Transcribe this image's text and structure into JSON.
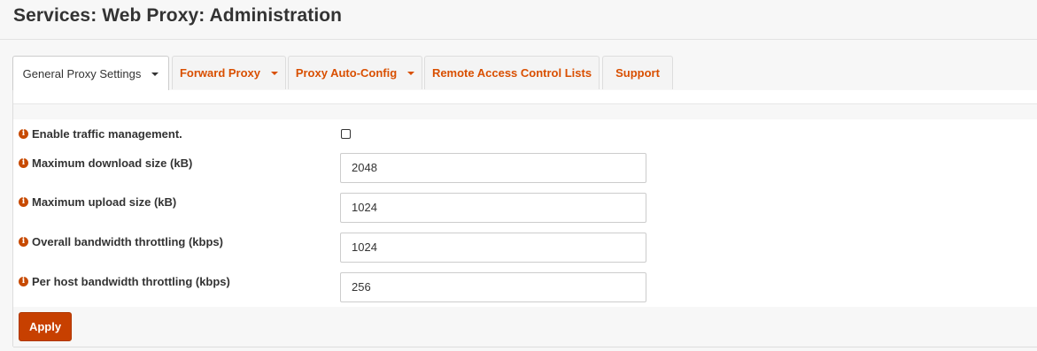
{
  "header": {
    "title": "Services: Web Proxy: Administration"
  },
  "tabs": [
    {
      "label": "General Proxy Settings",
      "active": true,
      "has_dropdown": true
    },
    {
      "label": "Forward Proxy",
      "active": false,
      "has_dropdown": true
    },
    {
      "label": "Proxy Auto-Config",
      "active": false,
      "has_dropdown": true
    },
    {
      "label": "Remote Access Control Lists",
      "active": false,
      "has_dropdown": false
    },
    {
      "label": "Support",
      "active": false,
      "has_dropdown": false
    }
  ],
  "form": {
    "enable_traffic": {
      "label": "Enable traffic management.",
      "checked": false,
      "icon": "info-icon"
    },
    "max_download": {
      "label": "Maximum download size (kB)",
      "value": "2048",
      "icon": "info-icon"
    },
    "max_upload": {
      "label": "Maximum upload size (kB)",
      "value": "1024",
      "icon": "info-icon"
    },
    "overall_bandwidth": {
      "label": "Overall bandwidth throttling (kbps)",
      "value": "1024",
      "icon": "info-icon"
    },
    "per_host_bandwidth": {
      "label": "Per host bandwidth throttling (kbps)",
      "value": "256",
      "icon": "info-icon"
    }
  },
  "actions": {
    "apply_label": "Apply"
  },
  "colors": {
    "accent": "#d94f00",
    "button": "#c74000",
    "info_icon": "#c74a00"
  }
}
